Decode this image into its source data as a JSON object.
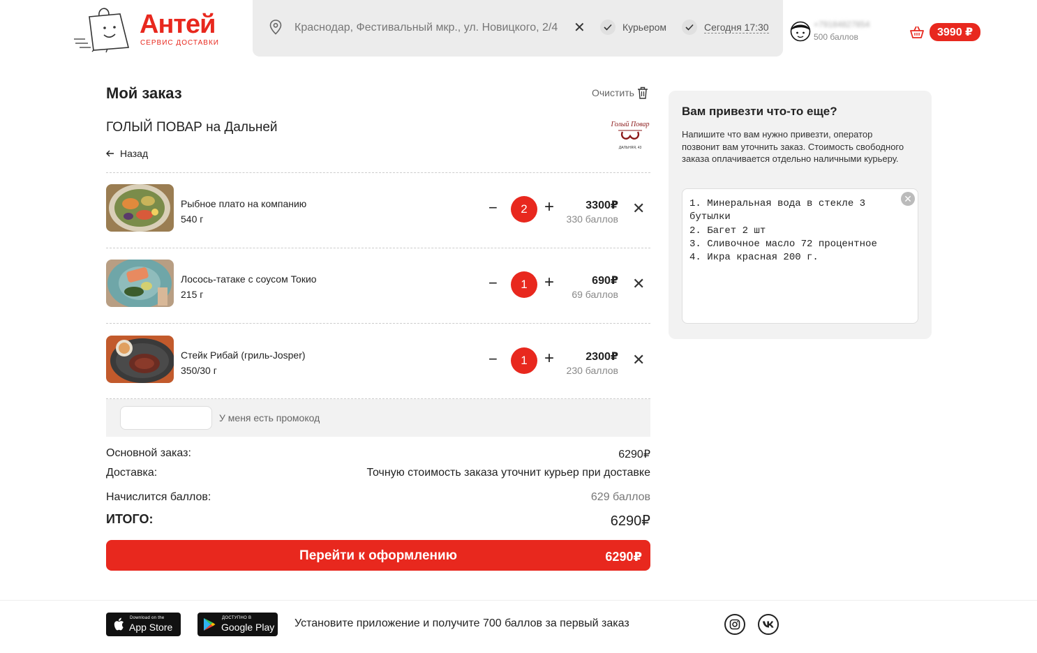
{
  "brand": {
    "name": "Антей",
    "subtitle": "СЕРВИС ДОСТАВКИ",
    "color": "#e8281e"
  },
  "header": {
    "address": "Краснодар, Фестивальный мкр., ул. Новицкого, 2/4",
    "delivery_option": "Курьером",
    "time_option": "Сегодня 17:30",
    "user_phone": "+79184827854",
    "user_points": "500 баллов",
    "cart_total": "3990 ₽"
  },
  "order": {
    "title": "Мой заказ",
    "clear_label": "Очистить",
    "restaurant": "ГОЛЫЙ ПОВАР на Дальней",
    "restaurant_logo_text": "Голый Повар",
    "restaurant_logo_sub": "ДАЛЬНЯЯ, 43",
    "back_label": "Назад",
    "items": [
      {
        "name": "Рыбное плато на компанию",
        "weight": "540 г",
        "qty": "2",
        "price": "3300₽",
        "points": "330 баллов"
      },
      {
        "name": "Лосось-татаке с соусом Токио",
        "weight": "215 г",
        "qty": "1",
        "price": "690₽",
        "points": "69 баллов"
      },
      {
        "name": "Стейк Рибай (гриль-Josper)",
        "weight": "350/30 г",
        "qty": "1",
        "price": "2300₽",
        "points": "230 баллов"
      }
    ],
    "promo_placeholder": "",
    "promo_label": "У меня есть промокод",
    "summary": {
      "main_label": "Основной заказ:",
      "main_value": "6290₽",
      "delivery_label": "Доставка:",
      "delivery_value": "Точную стоимость заказа уточнит курьер при доставке",
      "points_label": "Начислится баллов:",
      "points_value": "629 баллов",
      "total_label": "ИТОГО:",
      "total_value": "6290₽"
    },
    "checkout_label": "Перейти к оформлению",
    "checkout_amount": "6290₽"
  },
  "sidebar": {
    "title": "Вам привезти что-то еще?",
    "description": "Напишите что вам нужно привезти, оператор позвонит вам уточнить заказ. Стоимость свободного заказа оплачивается отдельно наличными курьеру.",
    "text": "1. Минеральная вода в стекле 3 бутылки\n2. Багет 2 шт\n3. Сливочное масло 72 процентное\n4. Икра красная 200 г."
  },
  "footer": {
    "appstore_small": "Download on the",
    "appstore_big": "App Store",
    "gplay_small": "ДОСТУПНО В",
    "gplay_big": "Google Play",
    "promo_text": "Установите приложение и получите 700 баллов за первый заказ",
    "socials": [
      "instagram-icon",
      "vk-icon"
    ]
  }
}
